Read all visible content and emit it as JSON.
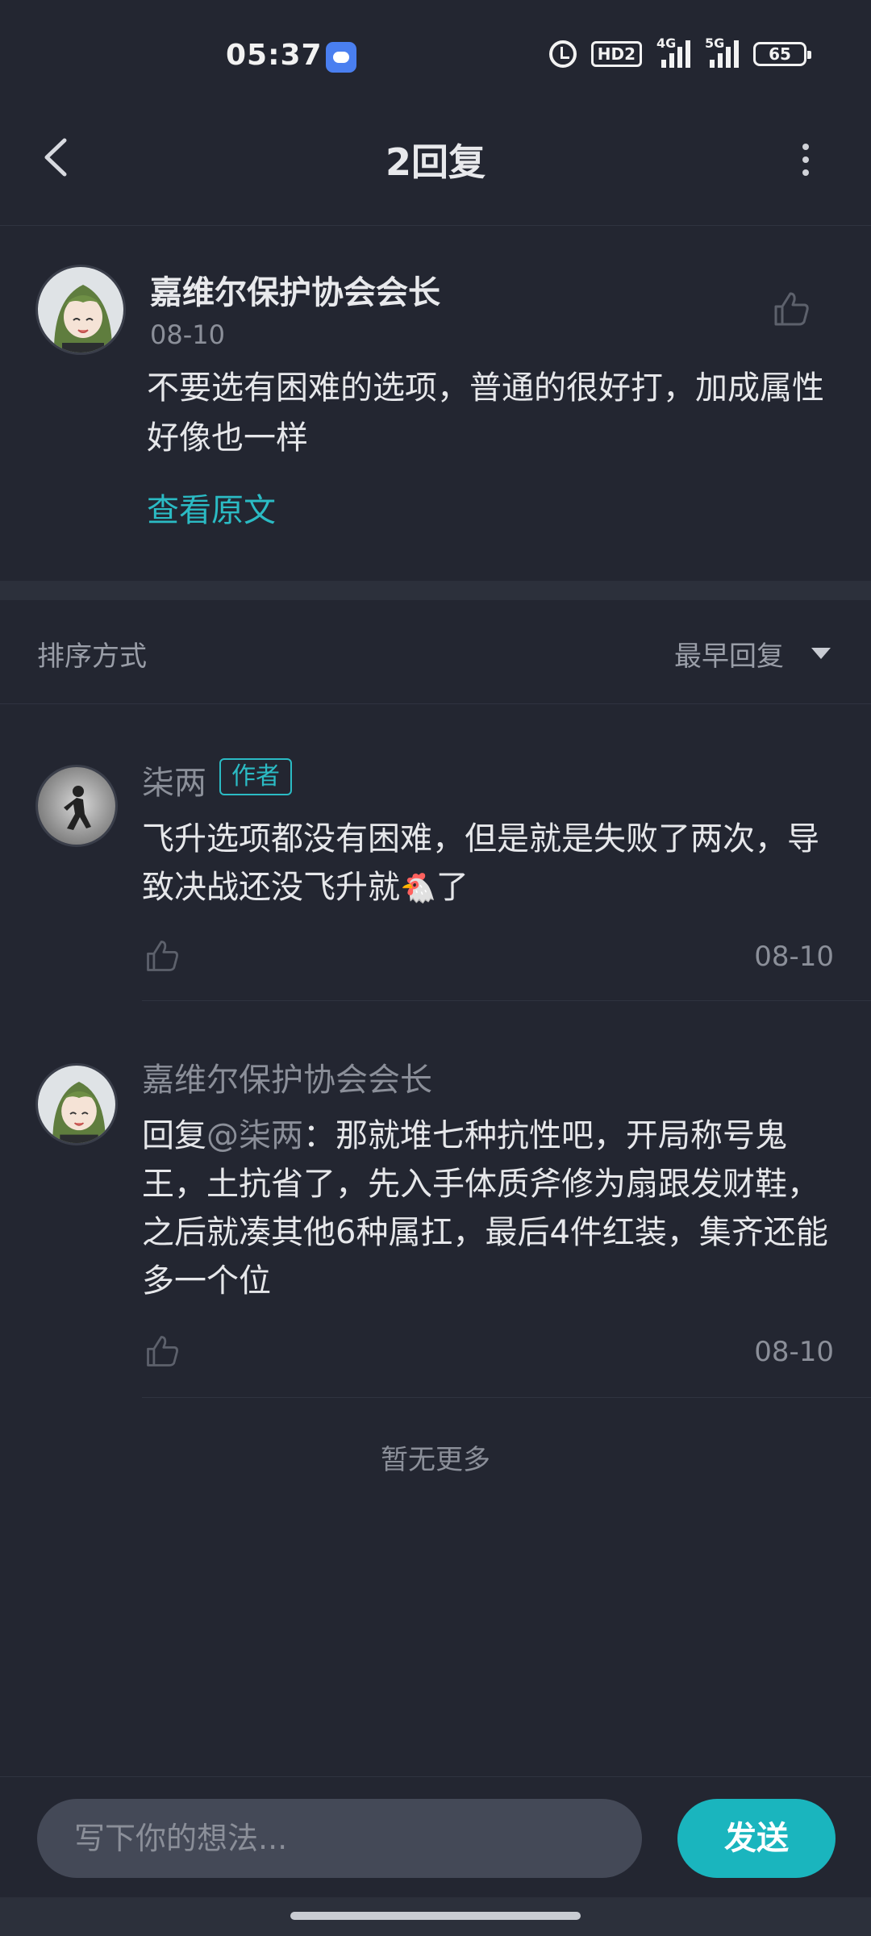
{
  "status_bar": {
    "time": "05:37",
    "hd_label": "HD2",
    "net1_label": "4G",
    "net2_label": "5G",
    "battery": "65"
  },
  "header": {
    "title": "2回复"
  },
  "main_post": {
    "username": "嘉维尔保护协会会长",
    "date": "08-10",
    "text": "不要选有困难的选项，普通的很好打，加成属性好像也一样",
    "view_original_label": "查看原文"
  },
  "sort": {
    "label": "排序方式",
    "value": "最早回复"
  },
  "replies": [
    {
      "username": "柒两",
      "badge": "作者",
      "text_part1": "飞升选项都没有困难，但是就是失败了两次，导致决战还没飞升就",
      "emoji": "🐔",
      "text_part2": "了",
      "date": "08-10"
    },
    {
      "username": "嘉维尔保护协会会长",
      "reply_prefix": "回复",
      "mention": "@柒两",
      "text": "：那就堆七种抗性吧，开局称号鬼王，土抗省了，先入手体质斧修为扇跟发财鞋，之后就凑其他6种属扛，最后4件红装，集齐还能多一个位",
      "date": "08-10"
    }
  ],
  "footer_note": "暂无更多",
  "composer": {
    "placeholder": "写下你的想法...",
    "send_label": "发送"
  },
  "colors": {
    "background": "#232631",
    "accent": "#2bbbc4",
    "send_button": "#1ab5be",
    "muted_text": "#8b8f99"
  }
}
